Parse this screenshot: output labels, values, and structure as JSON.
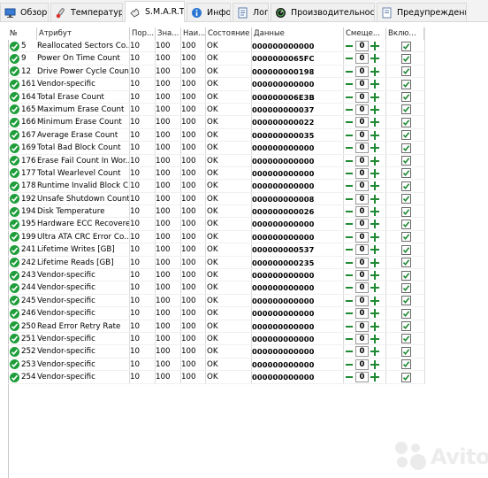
{
  "tabs": [
    {
      "label": "Обзор",
      "icon": "monitor-icon",
      "active": false
    },
    {
      "label": "Температура",
      "icon": "thermometer-icon",
      "active": false
    },
    {
      "label": "S.M.A.R.T.",
      "icon": "smart-hand-icon",
      "active": true
    },
    {
      "label": "Инфо",
      "icon": "info-icon",
      "active": false
    },
    {
      "label": "Лог",
      "icon": "log-icon",
      "active": false
    },
    {
      "label": "Производительность",
      "icon": "gauge-icon",
      "active": false
    },
    {
      "label": "Предупреждения",
      "icon": "warnings-icon",
      "active": false
    }
  ],
  "columns": {
    "num": "№",
    "attribute": "Атрибут",
    "threshold": "Пор...",
    "value": "Зна...",
    "worst": "Наи...",
    "status": "Состояние",
    "raw": "Данные",
    "offset": "Смеще...",
    "enabled": "Вклю..."
  },
  "rows": [
    {
      "id": "5",
      "name": "Reallocated Sectors Co...",
      "thr": "10",
      "val": "100",
      "wst": "100",
      "st": "OK",
      "raw": "000000000000",
      "off": "0"
    },
    {
      "id": "9",
      "name": "Power On Time Count",
      "thr": "10",
      "val": "100",
      "wst": "100",
      "st": "OK",
      "raw": "0000000065FC",
      "off": "0"
    },
    {
      "id": "12",
      "name": "Drive Power Cycle Count",
      "thr": "10",
      "val": "100",
      "wst": "100",
      "st": "OK",
      "raw": "000000000198",
      "off": "0"
    },
    {
      "id": "161",
      "name": "Vendor-specific",
      "thr": "10",
      "val": "100",
      "wst": "100",
      "st": "OK",
      "raw": "000000000000",
      "off": "0"
    },
    {
      "id": "164",
      "name": "Total Erase Count",
      "thr": "10",
      "val": "100",
      "wst": "100",
      "st": "OK",
      "raw": "000000006E3B",
      "off": "0"
    },
    {
      "id": "165",
      "name": "Maximum Erase Count",
      "thr": "10",
      "val": "100",
      "wst": "100",
      "st": "OK",
      "raw": "000000000037",
      "off": "0"
    },
    {
      "id": "166",
      "name": "Minimum Erase Count",
      "thr": "10",
      "val": "100",
      "wst": "100",
      "st": "OK",
      "raw": "000000000022",
      "off": "0"
    },
    {
      "id": "167",
      "name": "Average Erase Count",
      "thr": "10",
      "val": "100",
      "wst": "100",
      "st": "OK",
      "raw": "000000000035",
      "off": "0"
    },
    {
      "id": "169",
      "name": "Total Bad Block Count",
      "thr": "10",
      "val": "100",
      "wst": "100",
      "st": "OK",
      "raw": "000000000000",
      "off": "0"
    },
    {
      "id": "176",
      "name": "Erase Fail Count In Wor...",
      "thr": "10",
      "val": "100",
      "wst": "100",
      "st": "OK",
      "raw": "000000000000",
      "off": "0"
    },
    {
      "id": "177",
      "name": "Total Wearlevel Count",
      "thr": "10",
      "val": "100",
      "wst": "100",
      "st": "OK",
      "raw": "000000000000",
      "off": "0"
    },
    {
      "id": "178",
      "name": "Runtime Invalid Block C...",
      "thr": "10",
      "val": "100",
      "wst": "100",
      "st": "OK",
      "raw": "000000000000",
      "off": "0"
    },
    {
      "id": "192",
      "name": "Unsafe Shutdown Count",
      "thr": "10",
      "val": "100",
      "wst": "100",
      "st": "OK",
      "raw": "000000000008",
      "off": "0"
    },
    {
      "id": "194",
      "name": "Disk Temperature",
      "thr": "10",
      "val": "100",
      "wst": "100",
      "st": "OK",
      "raw": "000000000026",
      "off": "0"
    },
    {
      "id": "195",
      "name": "Hardware ECC Recovered",
      "thr": "10",
      "val": "100",
      "wst": "100",
      "st": "OK",
      "raw": "000000000000",
      "off": "0"
    },
    {
      "id": "199",
      "name": "Ultra ATA CRC Error Co...",
      "thr": "10",
      "val": "100",
      "wst": "100",
      "st": "OK",
      "raw": "000000000000",
      "off": "0"
    },
    {
      "id": "241",
      "name": "Lifetime Writes [GB]",
      "thr": "10",
      "val": "100",
      "wst": "100",
      "st": "OK",
      "raw": "000000000537",
      "off": "0"
    },
    {
      "id": "242",
      "name": "Lifetime Reads [GB]",
      "thr": "10",
      "val": "100",
      "wst": "100",
      "st": "OK",
      "raw": "000000000235",
      "off": "0"
    },
    {
      "id": "243",
      "name": "Vendor-specific",
      "thr": "10",
      "val": "100",
      "wst": "100",
      "st": "OK",
      "raw": "000000000000",
      "off": "0"
    },
    {
      "id": "244",
      "name": "Vendor-specific",
      "thr": "10",
      "val": "100",
      "wst": "100",
      "st": "OK",
      "raw": "000000000000",
      "off": "0"
    },
    {
      "id": "245",
      "name": "Vendor-specific",
      "thr": "10",
      "val": "100",
      "wst": "100",
      "st": "OK",
      "raw": "000000000000",
      "off": "0"
    },
    {
      "id": "246",
      "name": "Vendor-specific",
      "thr": "10",
      "val": "100",
      "wst": "100",
      "st": "OK",
      "raw": "000000000000",
      "off": "0"
    },
    {
      "id": "250",
      "name": "Read Error Retry Rate",
      "thr": "10",
      "val": "100",
      "wst": "100",
      "st": "OK",
      "raw": "000000000000",
      "off": "0"
    },
    {
      "id": "251",
      "name": "Vendor-specific",
      "thr": "10",
      "val": "100",
      "wst": "100",
      "st": "OK",
      "raw": "000000000000",
      "off": "0"
    },
    {
      "id": "252",
      "name": "Vendor-specific",
      "thr": "10",
      "val": "100",
      "wst": "100",
      "st": "OK",
      "raw": "000000000000",
      "off": "0"
    },
    {
      "id": "253",
      "name": "Vendor-specific",
      "thr": "10",
      "val": "100",
      "wst": "100",
      "st": "OK",
      "raw": "000000000000",
      "off": "0"
    },
    {
      "id": "254",
      "name": "Vendor-specific",
      "thr": "10",
      "val": "100",
      "wst": "100",
      "st": "OK",
      "raw": "000000000000",
      "off": "0"
    }
  ],
  "watermark": {
    "text": "Avito",
    "icon": "avito-logo-icon"
  },
  "colors": {
    "ok_green": "#1e9d3a",
    "control_green": "#1f8a33"
  }
}
